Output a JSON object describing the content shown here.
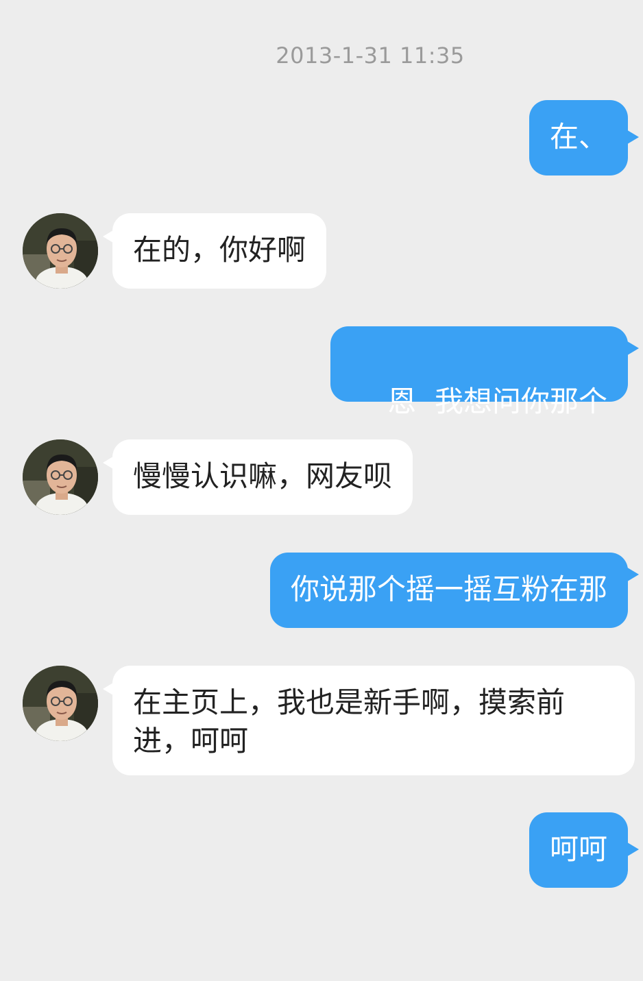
{
  "chat": {
    "timestamp": "2013-1-31 11:35",
    "messages": [
      {
        "side": "out",
        "text": "在、"
      },
      {
        "side": "in",
        "text": "在的，你好啊",
        "avatar": "person-photo"
      },
      {
        "side": "out",
        "text": "恩  我想问你那个"
      },
      {
        "side": "in",
        "text": "慢慢认识嘛，网友呗",
        "avatar": "person-photo"
      },
      {
        "side": "out",
        "text": "你说那个摇一摇互粉在那"
      },
      {
        "side": "in",
        "text": "在主页上，我也是新手啊，摸索前进，呵呵",
        "avatar": "person-photo"
      },
      {
        "side": "out",
        "text": "呵呵"
      }
    ]
  },
  "colors": {
    "background": "#ededed",
    "outgoing_bubble": "#3aa1f4",
    "incoming_bubble": "#ffffff",
    "timestamp_text": "#9a9a9a"
  }
}
